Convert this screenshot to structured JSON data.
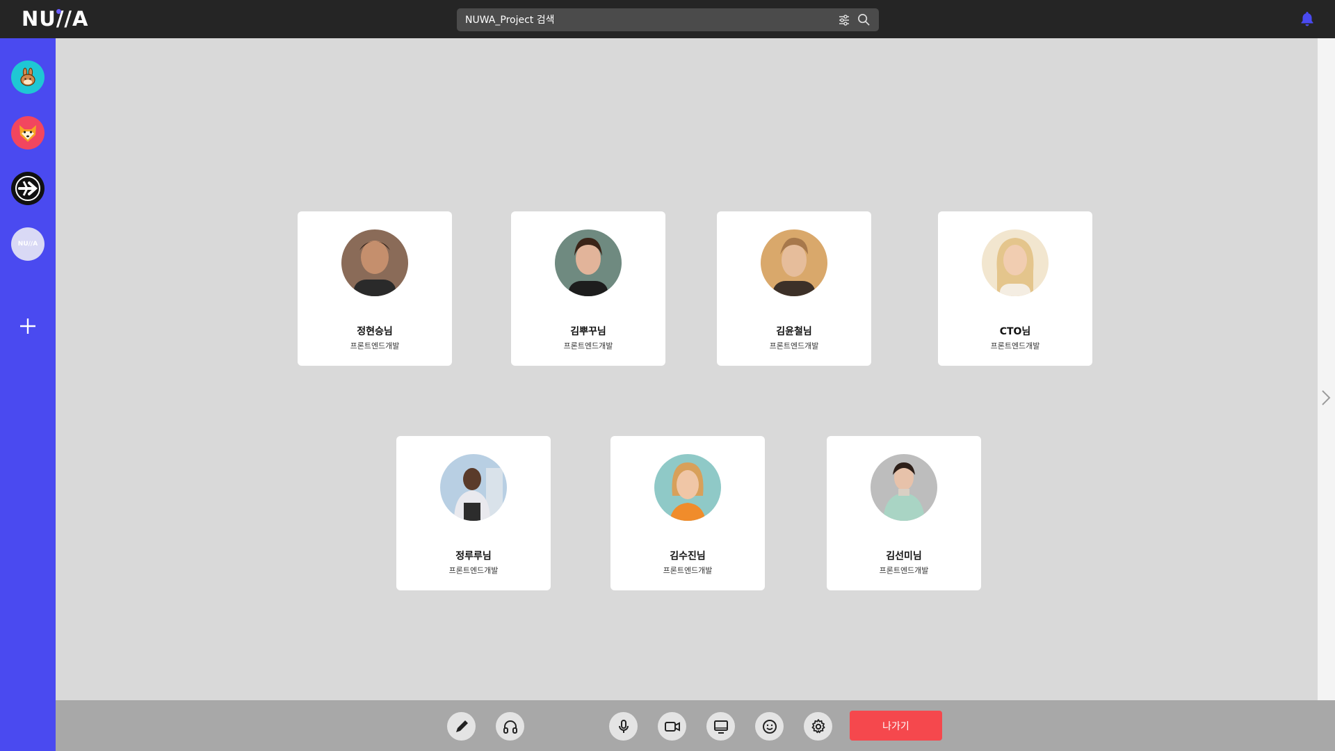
{
  "header": {
    "logo_text": "NU//A",
    "search_placeholder": "NUWA_Project 검색",
    "icons": [
      "filter-icon",
      "search-icon",
      "bell-icon"
    ],
    "accent_color": "#4a4af0"
  },
  "sidebar": {
    "servers": [
      {
        "name": "rabbit-server",
        "icon": "rabbit-icon",
        "color": "#1fc7d4"
      },
      {
        "name": "shiba-server",
        "icon": "shiba-icon",
        "color": "#f2465f"
      },
      {
        "name": "arrow-server",
        "icon": "arrow-logo-icon",
        "color": "#111111"
      },
      {
        "name": "nuwa-server",
        "icon": "nuwa-logo-icon",
        "color": "#d9d9f5",
        "label": "NU//A"
      }
    ],
    "add_icon": "plus-icon"
  },
  "participants": [
    {
      "name": "정현승님",
      "role": "프론트엔드개발"
    },
    {
      "name": "김뿌꾸님",
      "role": "프론트엔드개발"
    },
    {
      "name": "김윤철님",
      "role": "프론트엔드개발"
    },
    {
      "name": "CTO님",
      "role": "프론트엔드개발"
    },
    {
      "name": "정루루님",
      "role": "프론트엔드개발"
    },
    {
      "name": "김수진님",
      "role": "프론트엔드개발"
    },
    {
      "name": "김선미님",
      "role": "프론트엔드개발"
    }
  ],
  "controls": {
    "left": [
      "pen-icon",
      "headphones-icon"
    ],
    "right": [
      "microphone-icon",
      "video-camera-icon",
      "screen-share-icon",
      "emoji-icon",
      "settings-gear-icon"
    ],
    "leave_label": "나가기",
    "leave_color": "#f5484d"
  }
}
